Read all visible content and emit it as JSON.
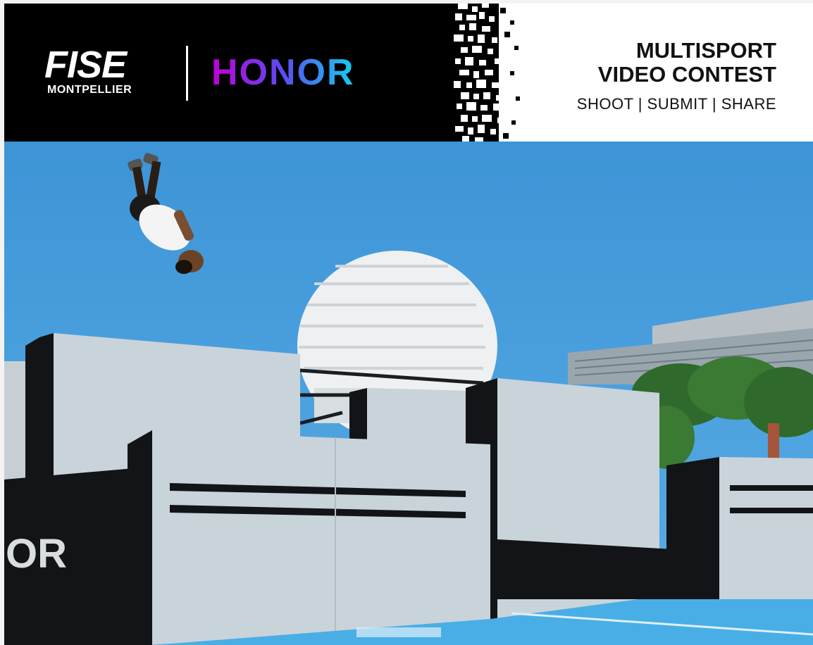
{
  "banner": {
    "fise_logo": "FISE",
    "fise_sublabel": "MONTPELLIER",
    "honor_logo": "HONOR",
    "contest_title_line1": "MULTISPORT",
    "contest_title_line2": "VIDEO CONTEST",
    "tagline": "SHOOT | SUBMIT | SHARE"
  },
  "photo": {
    "wall_partial_text": "OR"
  },
  "colors": {
    "sky": "#3d9bd8",
    "wall_light": "#c9d3da",
    "wall_dark": "#121417",
    "court": "#49aee6",
    "honor_gradient_start": "#c000d8",
    "honor_gradient_end": "#14d0f0"
  }
}
